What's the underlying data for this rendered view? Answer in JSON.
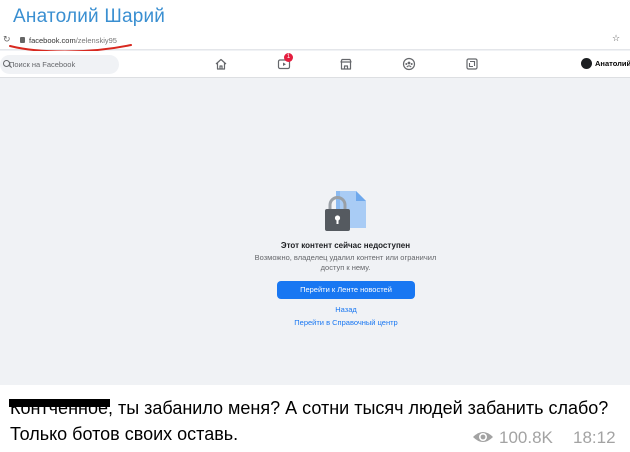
{
  "channel": {
    "name": "Анатолий Шарий"
  },
  "browser": {
    "reload_icon": "reload-icon",
    "url_host": "facebook.com",
    "url_path": "/zelenskiy95",
    "bookmark_icon": "star-icon"
  },
  "facebook": {
    "search_placeholder": "Поиск на Facebook",
    "nav": {
      "items": [
        {
          "name": "home-icon"
        },
        {
          "name": "watch-icon",
          "badge": "1"
        },
        {
          "name": "marketplace-icon"
        },
        {
          "name": "groups-icon"
        },
        {
          "name": "gaming-icon"
        }
      ]
    },
    "profile_name": "Анатолий"
  },
  "error": {
    "title": "Этот контент сейчас недоступен",
    "description": "Возможно, владелец удалил контент или ограничил доступ к нему.",
    "primary_button": "Перейти к Ленте новостей",
    "back_link": "Назад",
    "help_link": "Перейти в Справочный центр"
  },
  "message": {
    "redacted_word": "Контченное,",
    "text": " ты забанило меня? А сотни тысяч людей забанить слабо? Только ботов своих оставь.",
    "views": "100.8K",
    "time": "18:12"
  },
  "colors": {
    "channel_name": "#3a8fd1",
    "facebook_blue": "#1877f2",
    "annotation_red": "#d8281f",
    "meta_gray": "#a3a3a3"
  }
}
